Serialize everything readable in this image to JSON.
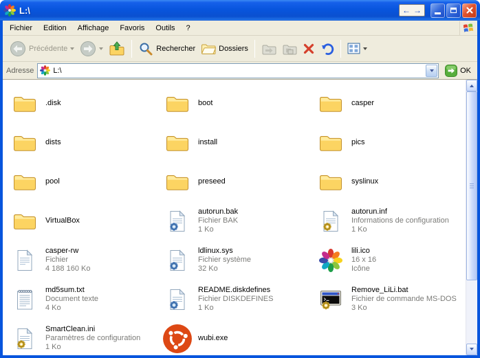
{
  "window": {
    "title": "L:\\"
  },
  "menu": {
    "items": [
      "Fichier",
      "Edition",
      "Affichage",
      "Favoris",
      "Outils",
      "?"
    ]
  },
  "toolbar": {
    "back_label": "Précédente",
    "search_label": "Rechercher",
    "folders_label": "Dossiers"
  },
  "address_bar": {
    "label": "Adresse",
    "value": "L:\\",
    "go_label": "OK"
  },
  "files": [
    {
      "name": ".disk",
      "icon": "folder-icon",
      "lines": []
    },
    {
      "name": "boot",
      "icon": "folder-icon",
      "lines": []
    },
    {
      "name": "casper",
      "icon": "folder-icon",
      "lines": []
    },
    {
      "name": "dists",
      "icon": "folder-icon",
      "lines": []
    },
    {
      "name": "install",
      "icon": "folder-icon",
      "lines": []
    },
    {
      "name": "pics",
      "icon": "folder-icon",
      "lines": []
    },
    {
      "name": "pool",
      "icon": "folder-icon",
      "lines": []
    },
    {
      "name": "preseed",
      "icon": "folder-icon",
      "lines": []
    },
    {
      "name": "syslinux",
      "icon": "folder-icon",
      "lines": []
    },
    {
      "name": "VirtualBox",
      "icon": "folder-icon",
      "lines": []
    },
    {
      "name": "autorun.bak",
      "icon": "system-file-icon",
      "lines": [
        "Fichier BAK",
        "1 Ko"
      ]
    },
    {
      "name": "autorun.inf",
      "icon": "config-file-icon",
      "lines": [
        "Informations de configuration",
        "1 Ko"
      ]
    },
    {
      "name": "casper-rw",
      "icon": "file-icon",
      "lines": [
        "Fichier",
        "4 188 160 Ko"
      ]
    },
    {
      "name": "ldlinux.sys",
      "icon": "system-file-icon",
      "lines": [
        "Fichier système",
        "32 Ko"
      ]
    },
    {
      "name": "lili.ico",
      "icon": "lili-flower-icon",
      "lines": [
        "16 x 16",
        "Icône"
      ]
    },
    {
      "name": "md5sum.txt",
      "icon": "text-file-icon",
      "lines": [
        "Document texte",
        "4 Ko"
      ]
    },
    {
      "name": "README.diskdefines",
      "icon": "system-file-icon",
      "lines": [
        "Fichier DISKDEFINES",
        "1 Ko"
      ]
    },
    {
      "name": "Remove_LiLi.bat",
      "icon": "msdos-file-icon",
      "lines": [
        "Fichier de commande MS-DOS",
        "3 Ko"
      ]
    },
    {
      "name": "SmartClean.ini",
      "icon": "config-file-icon",
      "lines": [
        "Paramètres de configuration",
        "1 Ko"
      ]
    },
    {
      "name": "wubi.exe",
      "icon": "ubuntu-icon",
      "lines": []
    }
  ],
  "colors": {
    "titlebar_blue": "#0855DD",
    "chrome_beige": "#EFECDD",
    "ubuntu_orange": "#DD4814",
    "delete_red": "#D5402C"
  }
}
